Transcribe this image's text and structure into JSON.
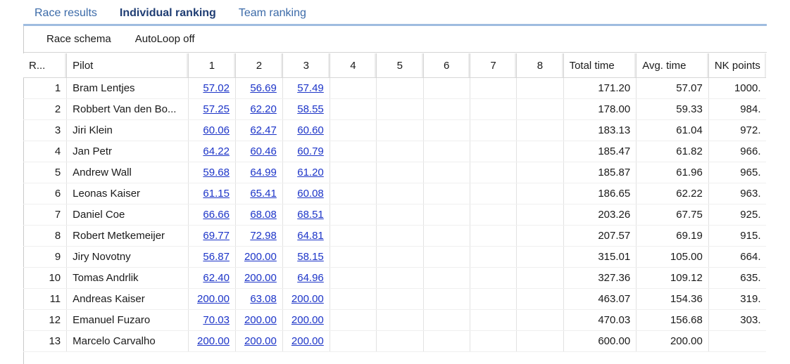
{
  "tabs": [
    {
      "label": "Race results",
      "active": false
    },
    {
      "label": "Individual ranking",
      "active": true
    },
    {
      "label": "Team ranking",
      "active": false
    }
  ],
  "toolbar": {
    "race_schema_label": "Race schema",
    "autoloop_label": "AutoLoop off"
  },
  "table": {
    "headers": [
      "R...",
      "Pilot",
      "1",
      "2",
      "3",
      "4",
      "5",
      "6",
      "7",
      "8",
      "Total time",
      "Avg. time",
      "NK points"
    ],
    "rows": [
      {
        "rank": "1",
        "pilot": "Bram Lentjes",
        "laps": [
          "57.02",
          "56.69",
          "57.49"
        ],
        "total": "171.20",
        "avg": "57.07",
        "points": "1000."
      },
      {
        "rank": "2",
        "pilot": "Robbert Van den Bo...",
        "laps": [
          "57.25",
          "62.20",
          "58.55"
        ],
        "total": "178.00",
        "avg": "59.33",
        "points": "984."
      },
      {
        "rank": "3",
        "pilot": "Jiri Klein",
        "laps": [
          "60.06",
          "62.47",
          "60.60"
        ],
        "total": "183.13",
        "avg": "61.04",
        "points": "972."
      },
      {
        "rank": "4",
        "pilot": "Jan Petr",
        "laps": [
          "64.22",
          "60.46",
          "60.79"
        ],
        "total": "185.47",
        "avg": "61.82",
        "points": "966."
      },
      {
        "rank": "5",
        "pilot": "Andrew Wall",
        "laps": [
          "59.68",
          "64.99",
          "61.20"
        ],
        "total": "185.87",
        "avg": "61.96",
        "points": "965."
      },
      {
        "rank": "6",
        "pilot": "Leonas Kaiser",
        "laps": [
          "61.15",
          "65.41",
          "60.08"
        ],
        "total": "186.65",
        "avg": "62.22",
        "points": "963."
      },
      {
        "rank": "7",
        "pilot": "Daniel Coe",
        "laps": [
          "66.66",
          "68.08",
          "68.51"
        ],
        "total": "203.26",
        "avg": "67.75",
        "points": "925."
      },
      {
        "rank": "8",
        "pilot": "Robert Metkemeijer",
        "laps": [
          "69.77",
          "72.98",
          "64.81"
        ],
        "total": "207.57",
        "avg": "69.19",
        "points": "915."
      },
      {
        "rank": "9",
        "pilot": "Jiry Novotny",
        "laps": [
          "56.87",
          "200.00",
          "58.15"
        ],
        "total": "315.01",
        "avg": "105.00",
        "points": "664."
      },
      {
        "rank": "10",
        "pilot": "Tomas Andrlik",
        "laps": [
          "62.40",
          "200.00",
          "64.96"
        ],
        "total": "327.36",
        "avg": "109.12",
        "points": "635."
      },
      {
        "rank": "11",
        "pilot": "Andreas Kaiser",
        "laps": [
          "200.00",
          "63.08",
          "200.00"
        ],
        "total": "463.07",
        "avg": "154.36",
        "points": "319."
      },
      {
        "rank": "12",
        "pilot": "Emanuel Fuzaro",
        "laps": [
          "70.03",
          "200.00",
          "200.00"
        ],
        "total": "470.03",
        "avg": "156.68",
        "points": "303."
      },
      {
        "rank": "13",
        "pilot": "Marcelo Carvalho",
        "laps": [
          "200.00",
          "200.00",
          "200.00"
        ],
        "total": "600.00",
        "avg": "200.00",
        "points": ""
      }
    ]
  },
  "colors": {
    "link": "#1c34c8",
    "tab_active": "#1f3d73",
    "tab_inactive": "#3b6aa8",
    "tab_rule": "#9fbce0"
  }
}
